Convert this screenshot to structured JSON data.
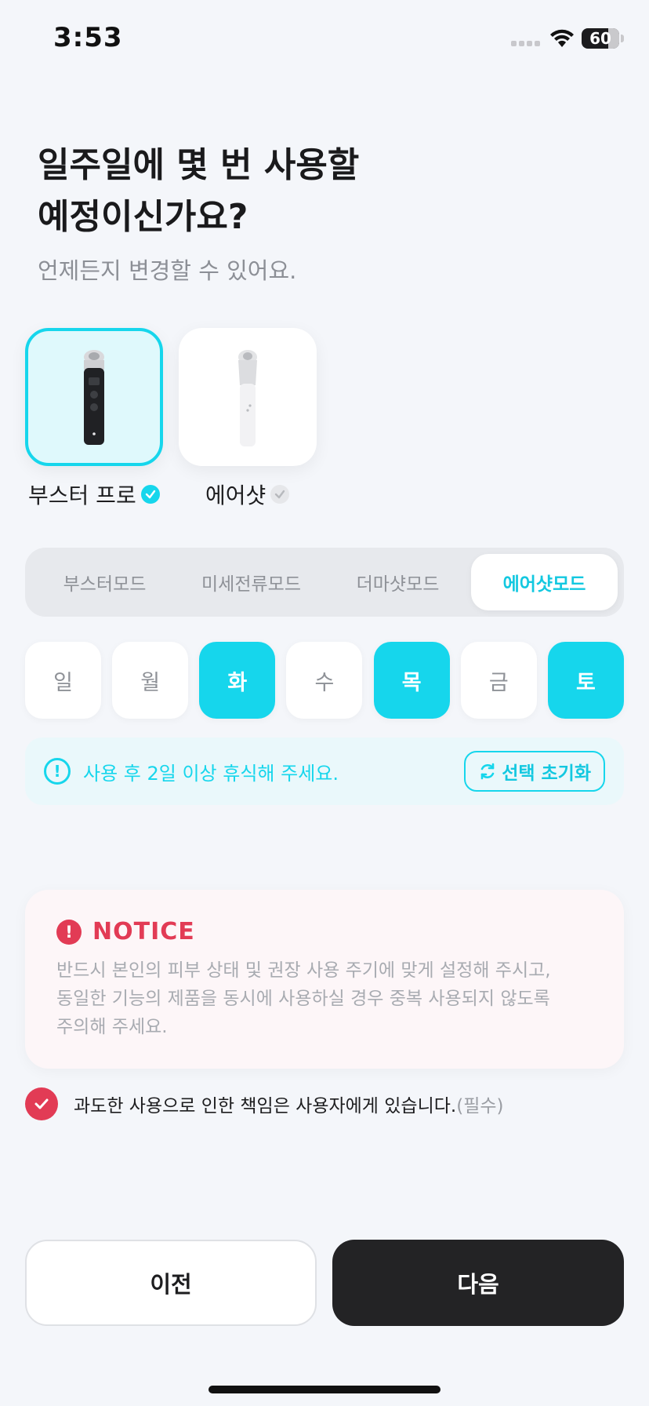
{
  "status_bar": {
    "time": "3:53",
    "battery": "60"
  },
  "header": {
    "title": "일주일에 몇 번 사용할\n예정이신가요?",
    "subtitle": "언제든지 변경할 수 있어요."
  },
  "devices": [
    {
      "label": "부스터 프로",
      "selected": true
    },
    {
      "label": "에어샷",
      "selected": false
    }
  ],
  "mode_tabs": [
    {
      "label": "부스터모드",
      "active": false
    },
    {
      "label": "미세전류모드",
      "active": false
    },
    {
      "label": "더마샷모드",
      "active": false
    },
    {
      "label": "에어샷모드",
      "active": true
    }
  ],
  "days": [
    {
      "label": "일",
      "selected": false
    },
    {
      "label": "월",
      "selected": false
    },
    {
      "label": "화",
      "selected": true
    },
    {
      "label": "수",
      "selected": false
    },
    {
      "label": "목",
      "selected": true
    },
    {
      "label": "금",
      "selected": false
    },
    {
      "label": "토",
      "selected": true
    }
  ],
  "info": {
    "icon_text": "!",
    "text": "사용 후 2일 이상 휴식해 주세요.",
    "reset_label": "선택 초기화"
  },
  "notice": {
    "icon_text": "!",
    "title": "NOTICE",
    "body": "반드시 본인의 피부 상태 및 권장 사용 주기에 맞게 설정해 주시고,\n동일한 기능의 제품을 동시에 사용하실 경우 중복 사용되지 않도록\n주의해 주세요."
  },
  "agreement": {
    "text": "과도한 사용으로 인한 책임은 사용자에게 있습니다.",
    "required": "(필수)",
    "checked": true
  },
  "buttons": {
    "prev": "이전",
    "next": "다음"
  },
  "colors": {
    "accent": "#16d6ec",
    "alert": "#e23b55",
    "dark_button": "#232325",
    "background": "#f4f6fa"
  }
}
